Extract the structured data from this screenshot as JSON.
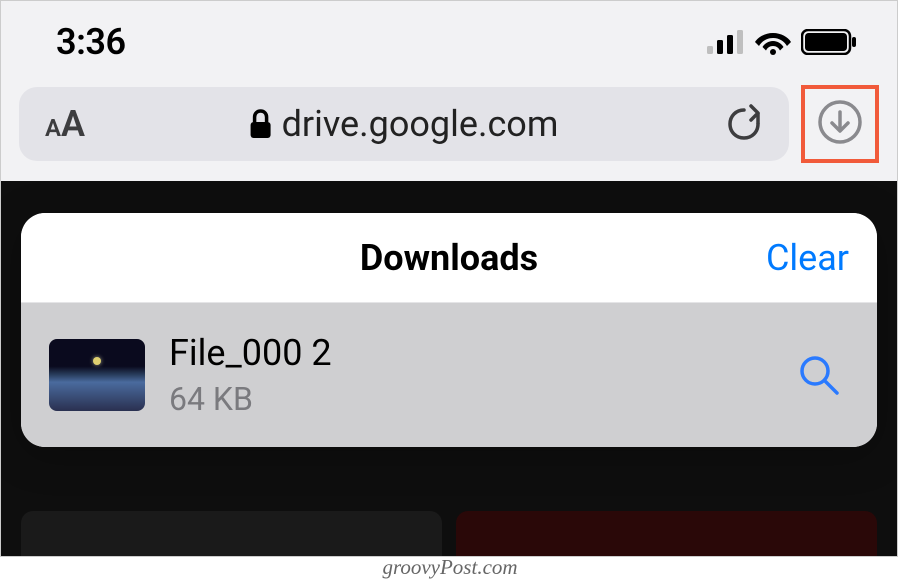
{
  "status_bar": {
    "time": "3:36"
  },
  "address_bar": {
    "url": "drive.google.com"
  },
  "popover": {
    "title": "Downloads",
    "clear_label": "Clear"
  },
  "download": {
    "file_name": "File_000 2",
    "file_size": "64 KB"
  },
  "watermark": "groovyPost.com"
}
